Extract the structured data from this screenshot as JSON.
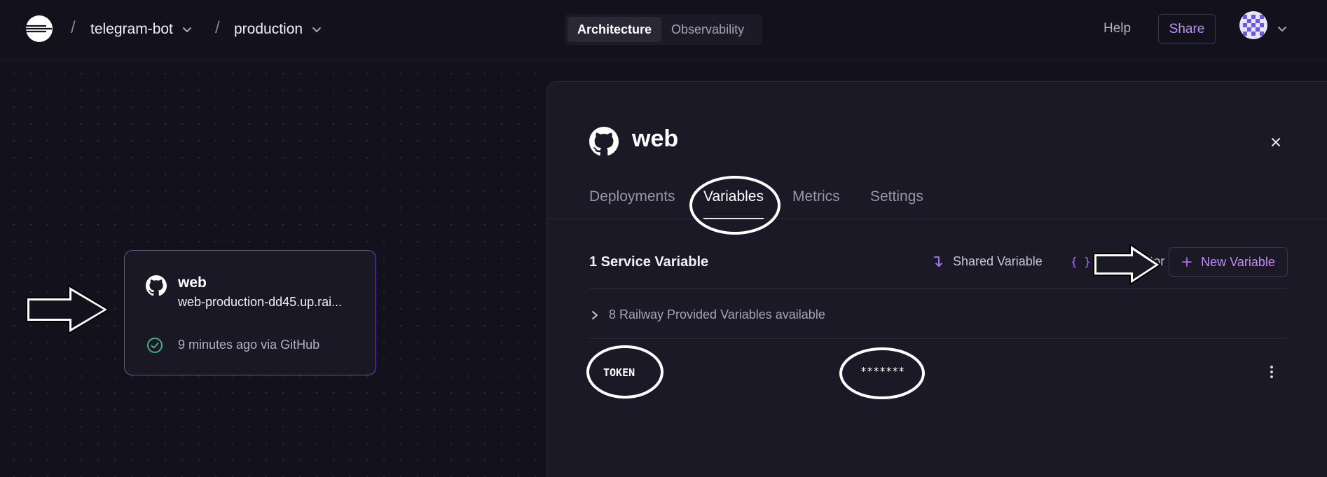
{
  "topbar": {
    "project_name": "telegram-bot",
    "environment_name": "production",
    "breadcrumb_separator": "/",
    "view_tabs": [
      {
        "label": "Architecture",
        "active": true
      },
      {
        "label": "Observability",
        "active": false
      }
    ],
    "help_label": "Help",
    "share_label": "Share"
  },
  "service_card": {
    "name": "web",
    "url": "web-production-dd45.up.rai...",
    "status": "9 minutes ago via GitHub",
    "status_color": "#3fb383"
  },
  "panel": {
    "title": "web",
    "tabs": [
      {
        "label": "Deployments",
        "active": false
      },
      {
        "label": "Variables",
        "active": true
      },
      {
        "label": "Metrics",
        "active": false
      },
      {
        "label": "Settings",
        "active": false
      }
    ],
    "section_title": "1 Service Variable",
    "shared_variable_label": "Shared Variable",
    "raw_editor_label": "RAW Editor",
    "new_variable_label": "New Variable",
    "provided_label": "8 Railway Provided Variables available",
    "variables": [
      {
        "key": "TOKEN",
        "value": "*******"
      }
    ]
  },
  "colors": {
    "background": "#13111c",
    "panel": "#1b1925",
    "accent": "#c08cf5",
    "card_border": "#6b4aa8"
  }
}
